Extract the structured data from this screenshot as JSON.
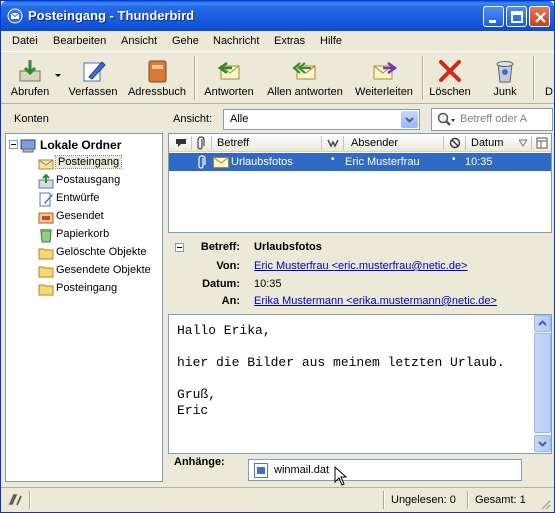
{
  "window": {
    "title": "Posteingang - Thunderbird"
  },
  "menu": [
    "Datei",
    "Bearbeiten",
    "Ansicht",
    "Gehe",
    "Nachricht",
    "Extras",
    "Hilfe"
  ],
  "toolbar": {
    "abrufen": "Abrufen",
    "verfassen": "Verfassen",
    "adressbuch": "Adressbuch",
    "antworten": "Antworten",
    "allen_antworten": "Allen antworten",
    "weiterleiten": "Weiterleiten",
    "loeschen": "Löschen",
    "junk": "Junk"
  },
  "subbar": {
    "konten_label": "Konten",
    "ansicht_label": "Ansicht:",
    "ansicht_value": "Alle",
    "search_placeholder": "Betreff oder A"
  },
  "folders": {
    "root": "Lokale Ordner",
    "items": [
      "Posteingang",
      "Postausgang",
      "Entwürfe",
      "Gesendet",
      "Papierkorb",
      "Gelöschte Objekte",
      "Gesendete Objekte",
      "Posteingang"
    ]
  },
  "message_list": {
    "columns": {
      "subject": "Betreff",
      "sender": "Absender",
      "date": "Datum"
    },
    "rows": [
      {
        "subject": "Urlaubsfotos",
        "sender": "Eric Musterfrau",
        "date": "10:35"
      }
    ]
  },
  "message": {
    "labels": {
      "subject": "Betreff:",
      "from": "Von:",
      "date": "Datum:",
      "to": "An:"
    },
    "subject": "Urlaubsfotos",
    "from": "Eric Musterfrau <eric.musterfrau@netic.de>",
    "date": "10:35",
    "to": "Erika Mustermann <erika.mustermann@netic.de>",
    "body": "Hallo Erika,\n\nhier die Bilder aus meinem letzten Urlaub.\n\nGruß,\nEric"
  },
  "attachments": {
    "label": "Anhänge:",
    "file": "winmail.dat"
  },
  "status": {
    "unread": "Ungelesen: 0",
    "total": "Gesamt: 1"
  }
}
